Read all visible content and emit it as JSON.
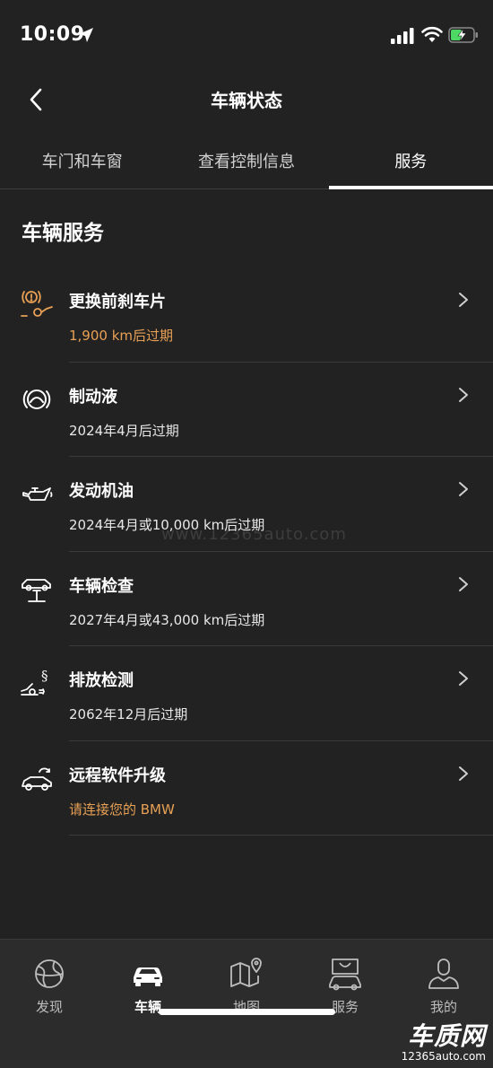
{
  "status_bar": {
    "time": "10:09"
  },
  "header": {
    "title": "车辆状态"
  },
  "tabs": [
    {
      "label": "车门和车窗",
      "active": false
    },
    {
      "label": "查看控制信息",
      "active": false
    },
    {
      "label": "服务",
      "active": true
    }
  ],
  "section": {
    "title": "车辆服务"
  },
  "services": [
    {
      "icon": "brake-pad-warning-icon",
      "name": "更换前刹车片",
      "status": "1,900 km后过期",
      "warning": true
    },
    {
      "icon": "brake-fluid-icon",
      "name": "制动液",
      "status": "2024年4月后过期",
      "warning": false
    },
    {
      "icon": "engine-oil-icon",
      "name": "发动机油",
      "status": "2024年4月或10,000 km后过期",
      "warning": false
    },
    {
      "icon": "vehicle-lift-icon",
      "name": "车辆检查",
      "status": "2027年4月或43,000 km后过期",
      "warning": false
    },
    {
      "icon": "emission-check-icon",
      "name": "排放检测",
      "status": "2062年12月后过期",
      "warning": false
    },
    {
      "icon": "remote-software-upgrade-icon",
      "name": "远程软件升级",
      "status": "请连接您的 BMW",
      "warning": true
    }
  ],
  "bottom_nav": [
    {
      "icon": "globe-icon",
      "label": "发现",
      "active": false
    },
    {
      "icon": "car-icon",
      "label": "车辆",
      "active": true
    },
    {
      "icon": "map-icon",
      "label": "地图",
      "active": false
    },
    {
      "icon": "shopping-bag-icon",
      "label": "服务",
      "active": false
    },
    {
      "icon": "user-icon",
      "label": "我的",
      "active": false
    }
  ],
  "watermark": {
    "text": "www.12365auto.com"
  },
  "corner_logo": {
    "main": "车质网",
    "sub": "12365auto.com"
  },
  "colors": {
    "background": "#222222",
    "warning": "#e8a055",
    "nav_background": "#2c2c2c"
  }
}
